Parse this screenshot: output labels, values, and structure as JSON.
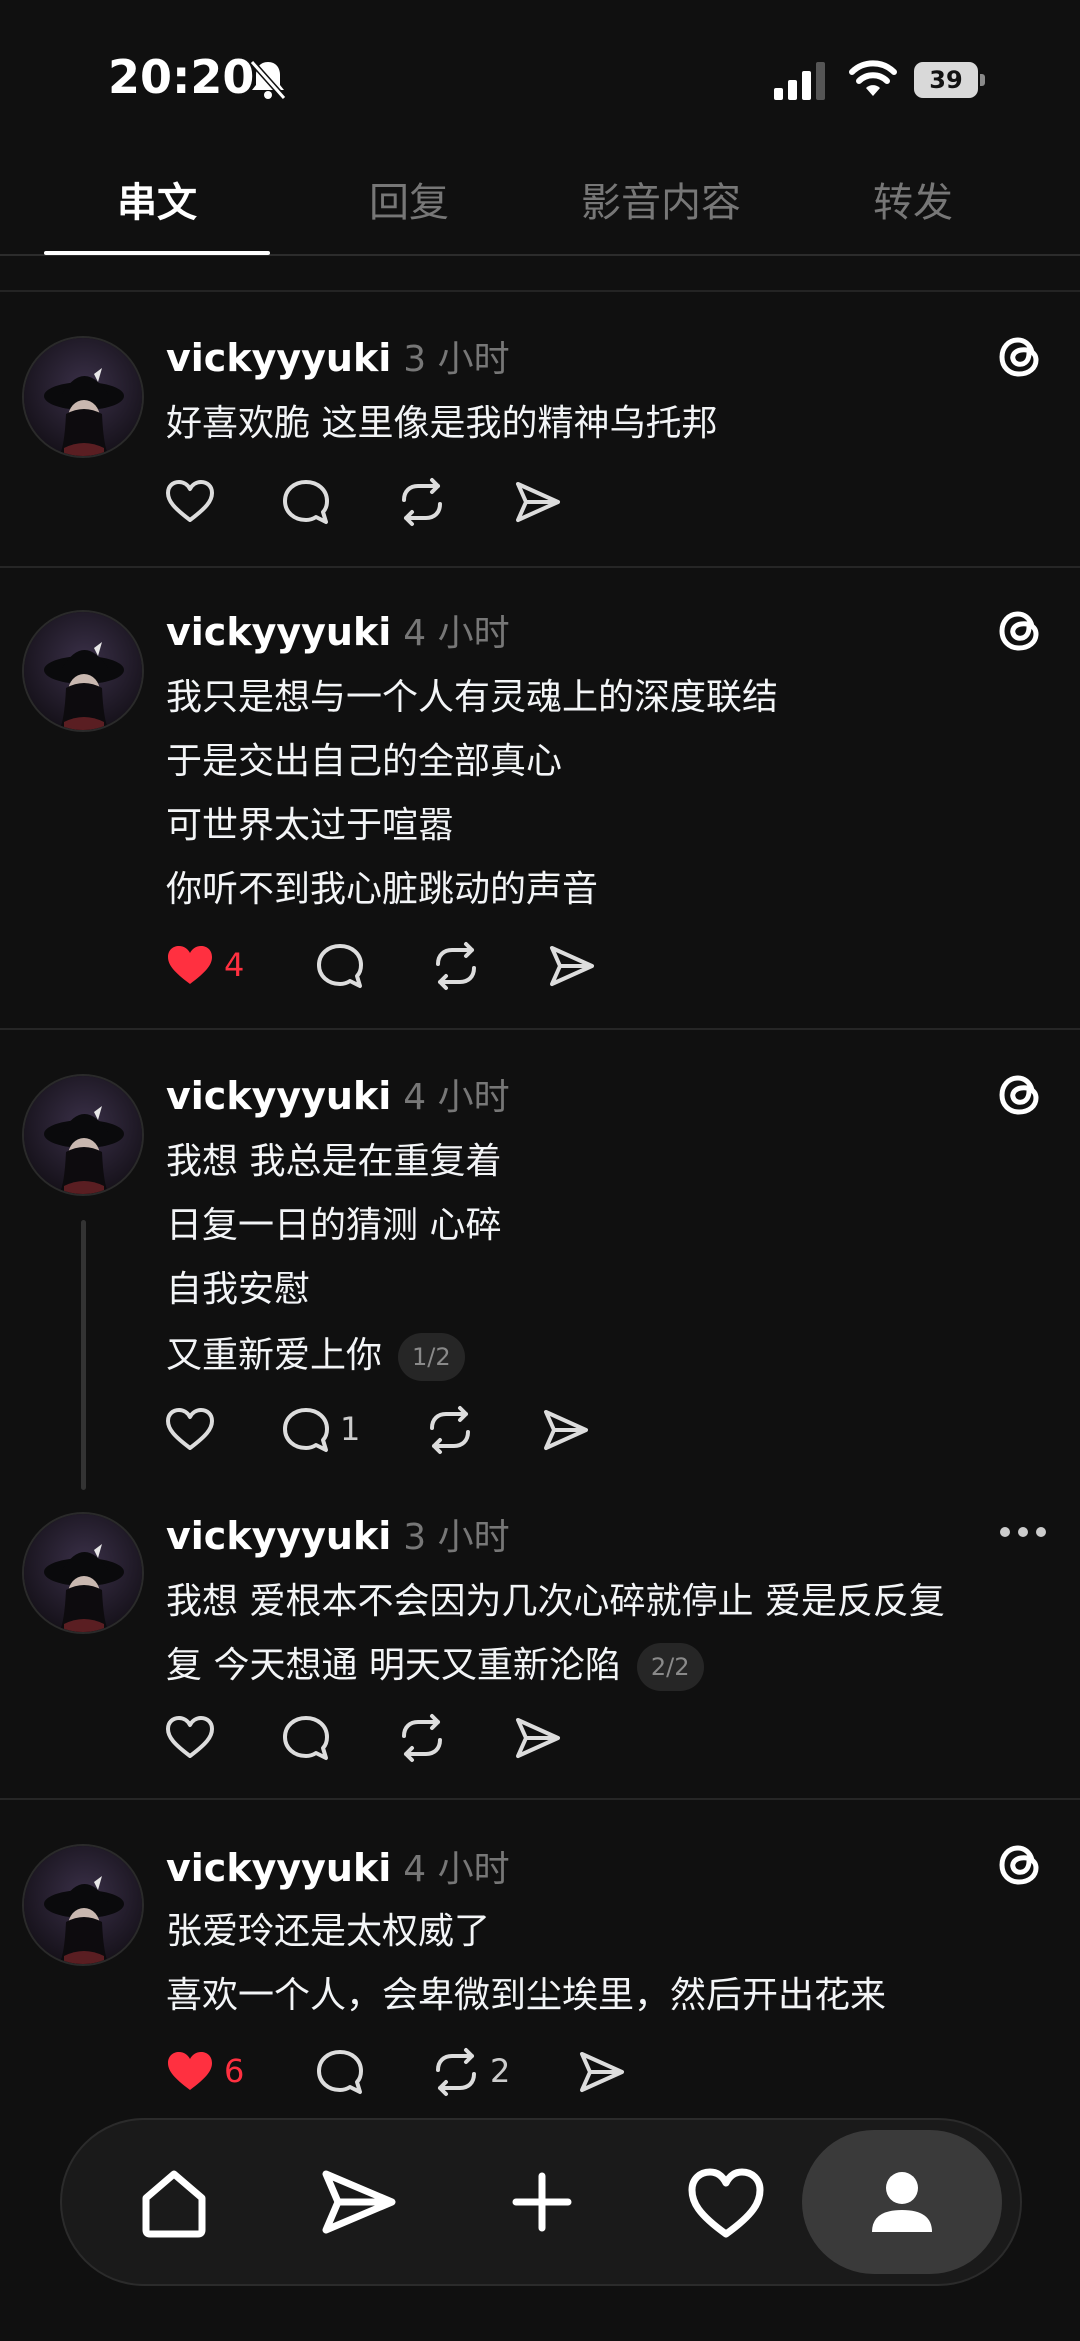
{
  "status_bar": {
    "time": "20:20",
    "battery": "39",
    "icons": [
      "bell-muted-icon",
      "signal-icon",
      "wifi-icon",
      "battery-icon"
    ]
  },
  "tabs": [
    {
      "label": "串文",
      "active": true
    },
    {
      "label": "回复",
      "active": false
    },
    {
      "label": "影音内容",
      "active": false
    },
    {
      "label": "转发",
      "active": false
    }
  ],
  "posts": [
    {
      "username": "vickyyyuki",
      "time": "3 小时",
      "lines": [
        "好喜欢脆 这里像是我的精神乌托邦"
      ],
      "likes": "",
      "liked": false,
      "replies": "",
      "reposts": "",
      "corner_icon": "threads-logo-icon"
    },
    {
      "username": "vickyyyuki",
      "time": "4 小时",
      "lines": [
        "我只是想与一个人有灵魂上的深度联结",
        "于是交出自己的全部真心",
        "可世界太过于喧嚣",
        "你听不到我心脏跳动的声音"
      ],
      "likes": "4",
      "liked": true,
      "replies": "",
      "reposts": "",
      "corner_icon": "threads-logo-icon"
    },
    {
      "username": "vickyyyuki",
      "time": "4 小时",
      "lines": [
        "我想 我总是在重复着",
        "日复一日的猜测 心碎",
        "自我安慰",
        "又重新爱上你"
      ],
      "page": "1/2",
      "likes": "",
      "liked": false,
      "replies": "1",
      "reposts": "",
      "corner_icon": "threads-logo-icon"
    },
    {
      "username": "vickyyyuki",
      "time": "3 小时",
      "lines": [
        "我想 爱根本不会因为几次心碎就停止 爱是反反复",
        "复 今天想通 明天又重新沦陷"
      ],
      "page": "2/2",
      "likes": "",
      "liked": false,
      "replies": "",
      "reposts": "",
      "corner_icon": "more-icon"
    },
    {
      "username": "vickyyyuki",
      "time": "4 小时",
      "lines": [
        "张爱玲还是太权威了",
        "喜欢一个人，会卑微到尘埃里，然后开出花来"
      ],
      "likes": "6",
      "liked": true,
      "replies": "",
      "reposts": "2",
      "corner_icon": "threads-logo-icon"
    }
  ],
  "bottom_nav": [
    "home-icon",
    "send-icon",
    "plus-icon",
    "heart-icon",
    "profile-icon"
  ],
  "colors": {
    "background": "#101010",
    "like_red": "#ff3040",
    "muted": "#777777"
  }
}
